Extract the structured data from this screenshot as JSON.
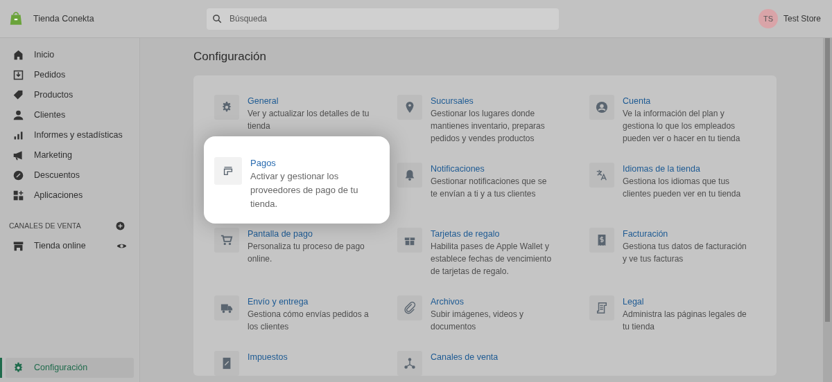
{
  "store": {
    "name": "Tienda Conekta"
  },
  "search": {
    "placeholder": "Búsqueda"
  },
  "account": {
    "initials": "TS",
    "name": "Test Store"
  },
  "sidebar": {
    "items": [
      {
        "label": "Inicio",
        "selected": false
      },
      {
        "label": "Pedidos",
        "selected": false
      },
      {
        "label": "Productos",
        "selected": false
      },
      {
        "label": "Clientes",
        "selected": false
      },
      {
        "label": "Informes y estadísticas",
        "selected": false
      },
      {
        "label": "Marketing",
        "selected": false
      },
      {
        "label": "Descuentos",
        "selected": false
      },
      {
        "label": "Aplicaciones",
        "selected": false
      }
    ],
    "channels_heading": "CANALES DE VENTA",
    "channels": [
      {
        "label": "Tienda online",
        "selected": false
      }
    ],
    "footer_items": [
      {
        "label": "Configuración",
        "selected": true
      }
    ]
  },
  "page": {
    "title": "Configuración"
  },
  "settings": [
    {
      "title": "General",
      "description": "Ver y actualizar los detalles de tu tienda",
      "highlighted": false
    },
    {
      "title": "Sucursales",
      "description": "Gestionar los lugares donde mantienes inventario, preparas pedidos y vendes productos",
      "highlighted": false
    },
    {
      "title": "Cuenta",
      "description": "Ve la información del plan y gestiona lo que los empleados pueden ver o hacer en tu tienda",
      "highlighted": false
    },
    {
      "title": "Pagos",
      "description": "Activar y gestionar los proveedores de pago de tu tienda.",
      "highlighted": true
    },
    {
      "title": "Notificaciones",
      "description": "Gestionar notificaciones que se te envían a ti y a tus clientes",
      "highlighted": false
    },
    {
      "title": "Idiomas de la tienda",
      "description": "Gestiona los idiomas que tus clientes pueden ver en tu tienda",
      "highlighted": false
    },
    {
      "title": "Pantalla de pago",
      "description": "Personaliza tu proceso de pago online.",
      "highlighted": false
    },
    {
      "title": "Tarjetas de regalo",
      "description": "Habilita pases de Apple Wallet y establece fechas de vencimiento de tarjetas de regalo.",
      "highlighted": false
    },
    {
      "title": "Facturación",
      "description": "Gestiona tus datos de facturación y ve tus facturas",
      "highlighted": false
    },
    {
      "title": "Envío y entrega",
      "description": "Gestiona cómo envías pedidos a los clientes",
      "highlighted": false
    },
    {
      "title": "Archivos",
      "description": "Subir imágenes, videos y documentos",
      "highlighted": false
    },
    {
      "title": "Legal",
      "description": "Administra las páginas legales de tu tienda",
      "highlighted": false
    },
    {
      "title": "Impuestos",
      "highlighted": false
    },
    {
      "title": "Canales de venta",
      "highlighted": false
    }
  ]
}
